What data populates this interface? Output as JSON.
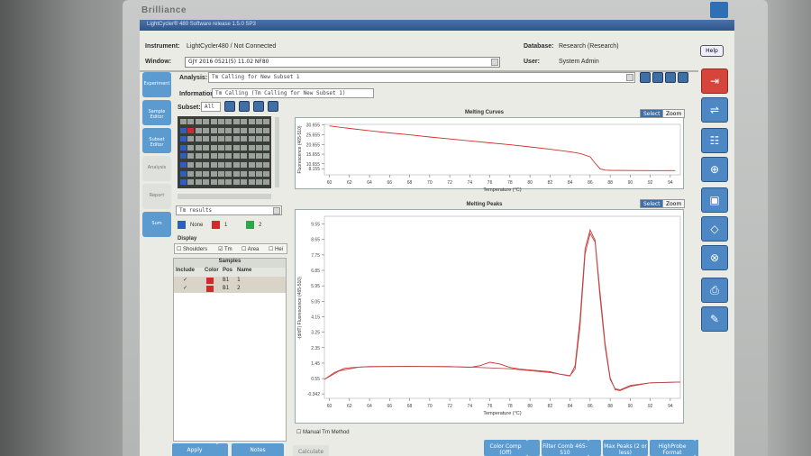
{
  "bezel": {
    "brand": "Brilliance"
  },
  "app": {
    "title": "LightCycler® 480 Software release 1.5.0 SP3",
    "instrument_label": "Instrument:",
    "instrument_value": "LightCycler480 / Not Connected",
    "window_label": "Window:",
    "window_value": "GJY 2016 0521(5) 11.02 NF80",
    "database_label": "Database:",
    "database_value": "Research (Research)",
    "user_label": "User:",
    "user_value": "System Admin",
    "help": "Help"
  },
  "nav": [
    {
      "label": "Experiment",
      "active": true
    },
    {
      "label": "Sample Editor",
      "active": true
    },
    {
      "label": "Subset Editor",
      "active": true
    },
    {
      "label": "Analysis",
      "active": false
    },
    {
      "label": "Report",
      "active": false
    },
    {
      "label": "Sum",
      "active": true
    }
  ],
  "analysis": {
    "analysis_label": "Analysis:",
    "analysis_value": "Tm Calling for New Subset 1",
    "information_label": "Information",
    "information_value": "Tm Calling (Tm Calling for New Subset 1)",
    "subset_label": "Subset:",
    "subset_value": "All"
  },
  "results": {
    "dropdown": "Tm results",
    "legend": [
      {
        "label": "None",
        "color": "#2e5fc0"
      },
      {
        "label": "1",
        "color": "#d02a2a"
      },
      {
        "label": "2",
        "color": "#2aa84a"
      }
    ],
    "display_title": "Display",
    "display_options": [
      {
        "label": "Shoulders",
        "checked": false
      },
      {
        "label": "Tm",
        "checked": true
      },
      {
        "label": "Area",
        "checked": false
      },
      {
        "label": "Hei",
        "checked": false
      }
    ]
  },
  "samples": {
    "title": "Samples",
    "columns": [
      "Include",
      "Color",
      "Pos",
      "Name"
    ],
    "rows": [
      {
        "pos": "B1",
        "name": "1",
        "color": "#d02a2a"
      },
      {
        "pos": "B1",
        "name": "2",
        "color": "#d02a2a"
      }
    ]
  },
  "buttons": {
    "apply": "Apply",
    "notes": "Notes",
    "calculate": "Calculate",
    "manual_tm": "Manual Tm Method",
    "select": "Select",
    "zoom": "Zoom",
    "color_comp": "Color Comp (Off)",
    "filter_comb": "Filter Comb 465-510",
    "max_peaks": "Max Peaks (2 or less)",
    "highprobe": "HighProbe Format"
  },
  "chart_data": [
    {
      "type": "line",
      "title": "Melting Curves",
      "xlabel": "Temperature (°C)",
      "ylabel": "Fluorescence (465-510)",
      "x_ticks": [
        60,
        62,
        64,
        66,
        68,
        70,
        72,
        74,
        76,
        78,
        80,
        82,
        84,
        86,
        88,
        90,
        92,
        94
      ],
      "y_ticks": [
        30.655,
        25.655,
        20.655,
        15.655,
        10.655,
        8.155
      ],
      "ylim": [
        5,
        31
      ],
      "xlim": [
        59.5,
        95
      ],
      "series": [
        {
          "color": "#d23030",
          "x": [
            60,
            62,
            64,
            66,
            68,
            70,
            72,
            74,
            76,
            78,
            80,
            82,
            84,
            85,
            86,
            86.5,
            87,
            87.5,
            88,
            90,
            92,
            94.5
          ],
          "y": [
            30.2,
            28.9,
            27.7,
            26.6,
            25.6,
            24.5,
            23.5,
            22.5,
            21.5,
            20.5,
            19.4,
            18.2,
            16.9,
            16.0,
            14.3,
            11.0,
            8.1,
            7.4,
            7.3,
            7.25,
            7.2,
            7.2
          ]
        }
      ]
    },
    {
      "type": "line",
      "title": "Melting Peaks",
      "xlabel": "Temperature (°C)",
      "ylabel": "-(d/dT) Fluorescence (465-510)",
      "x_ticks": [
        60,
        62,
        64,
        66,
        68,
        70,
        72,
        74,
        76,
        78,
        80,
        82,
        84,
        86,
        88,
        90,
        92,
        94
      ],
      "y_ticks": [
        9.55,
        8.65,
        7.75,
        6.85,
        5.95,
        5.05,
        4.15,
        3.25,
        2.35,
        1.45,
        0.55,
        -0.342
      ],
      "ylim": [
        -0.6,
        10.0
      ],
      "xlim": [
        59.5,
        95
      ],
      "series": [
        {
          "color": "#d23030",
          "x": [
            59.5,
            60.5,
            61.5,
            62.5,
            64,
            66,
            68,
            70,
            72,
            74,
            75,
            76,
            77,
            78,
            79,
            80,
            82,
            83,
            84,
            84.5,
            85,
            85.5,
            86,
            86.5,
            87,
            87.5,
            88,
            88.5,
            89,
            90,
            92,
            95
          ],
          "y": [
            0.5,
            0.9,
            1.15,
            1.2,
            1.25,
            1.25,
            1.27,
            1.25,
            1.25,
            1.2,
            1.3,
            1.5,
            1.4,
            1.2,
            1.1,
            1.05,
            0.95,
            0.8,
            0.7,
            1.3,
            4.0,
            8.1,
            9.2,
            8.6,
            5.5,
            2.6,
            0.6,
            -0.1,
            -0.15,
            0.1,
            0.3,
            0.35
          ]
        },
        {
          "color": "#b85050",
          "x": [
            59.5,
            61,
            63,
            66,
            70,
            74,
            78,
            82,
            84,
            84.5,
            85,
            85.5,
            86,
            86.5,
            87,
            87.5,
            88,
            88.5,
            89,
            90,
            92,
            95
          ],
          "y": [
            0.5,
            1.0,
            1.22,
            1.26,
            1.25,
            1.22,
            1.12,
            0.9,
            0.72,
            1.1,
            3.6,
            7.8,
            9.0,
            8.5,
            5.2,
            2.4,
            0.5,
            -0.05,
            -0.1,
            0.15,
            0.3,
            0.35
          ]
        }
      ]
    }
  ]
}
